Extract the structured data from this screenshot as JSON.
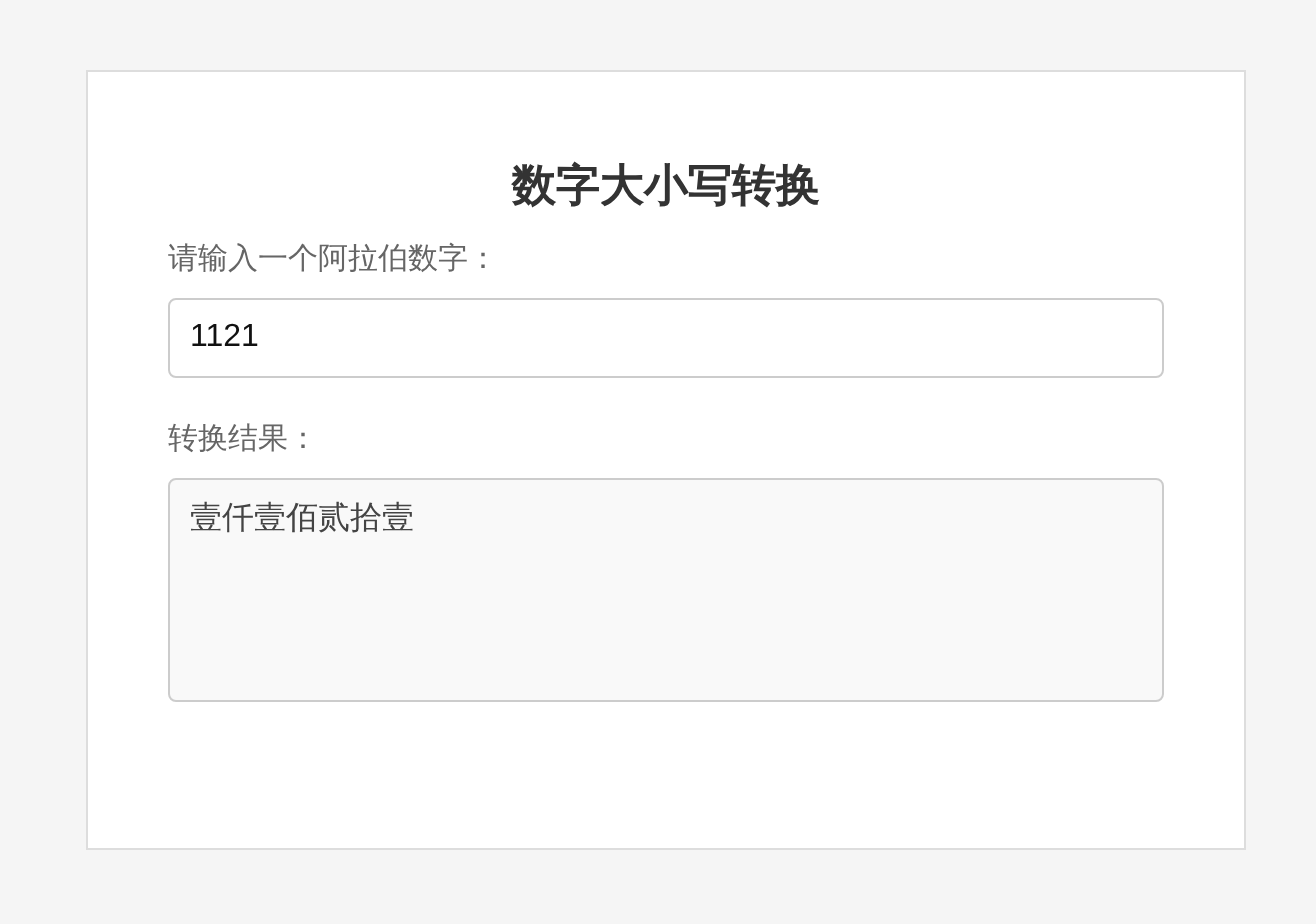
{
  "card": {
    "title": "数字大小写转换",
    "input_label": "请输入一个阿拉伯数字：",
    "input": {
      "value": "1121"
    },
    "result_label": "转换结果：",
    "result": {
      "value": "壹仟壹佰贰拾壹"
    }
  }
}
